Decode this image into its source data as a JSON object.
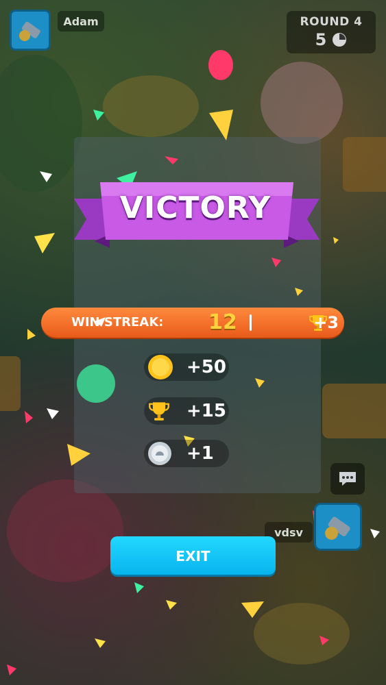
{
  "header": {
    "player_name": "Adam",
    "round_label": "ROUND 4",
    "round_time": "5"
  },
  "result": {
    "title": "VICTORY"
  },
  "win_streak": {
    "label": "WIN STREAK:",
    "value": "12",
    "trophy_bonus": "+3"
  },
  "rewards": [
    {
      "icon": "coin-icon",
      "value": "+50"
    },
    {
      "icon": "trophy-icon",
      "value": "+15"
    },
    {
      "icon": "silver-medal-icon",
      "value": "+1"
    }
  ],
  "opponent": {
    "name": "vdsv"
  },
  "actions": {
    "exit_label": "EXIT"
  },
  "colors": {
    "ribbon": "#c85ae6",
    "streak_bar": "#f0702a",
    "exit_button": "#14c6f4",
    "gold": "#ffc21a"
  }
}
